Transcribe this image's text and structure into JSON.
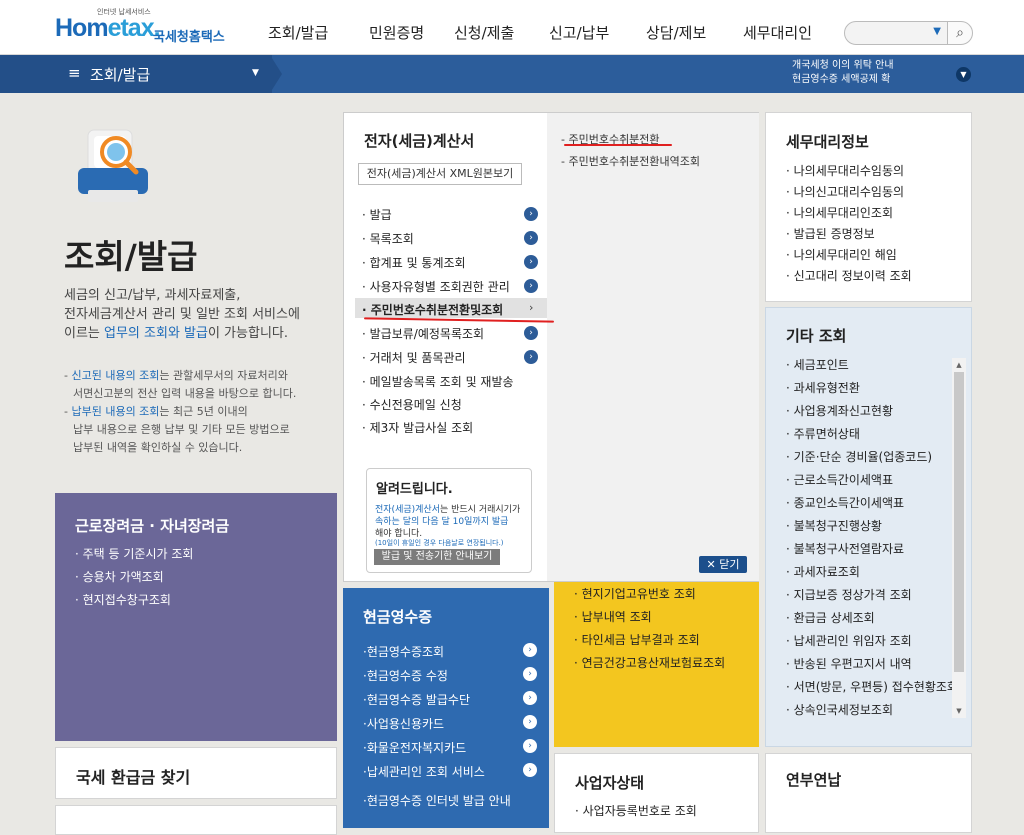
{
  "header": {
    "logo_main": "Hom",
    "logo_accent": "etax.",
    "logo_tagline": "인터넷 납세서비스",
    "logo_subtitle": "국세청홈택스",
    "menu": [
      "조회/발급",
      "민원증명",
      "신청/제출",
      "신고/납부",
      "상담/제보",
      "세무대리인"
    ],
    "search_placeholder": ""
  },
  "subbar": {
    "title": "조회/발급",
    "notices": [
      "개국세청 이의 위탁 안내",
      "현금영수증 세액공제 확"
    ]
  },
  "hero": {
    "title": "조회/발급",
    "desc_line1": "세금의 신고/납부, 과세자료제출,",
    "desc_line2": "전자세금계산서 관리 및 일반 조회 서비스에",
    "desc_line3_pre": "이르는 ",
    "desc_line3_hl": "업무의 조회와 발급",
    "desc_line3_post": "이 가능합니다.",
    "note1_pre": "- ",
    "note1_hl": "신고된 내용의 조회",
    "note1_post": "는 관할세무서의 자료처리와",
    "note1_line2": "서면신고분의 전산 입력 내용을 바탕으로 합니다.",
    "note2_pre": "- ",
    "note2_hl": "납부된 내용의 조회",
    "note2_post": "는 최근 5년 이내의",
    "note2_line2": "납부 내용으로 은행 납부 및 기타 모든 방법으로",
    "note2_line3": "납부된 내역을 확인하실 수 있습니다."
  },
  "purple_card": {
    "title": "근로장려금 · 자녀장려금",
    "items": [
      "· 주택 등 기준시가 조회",
      "· 승용차 가액조회",
      "· 현지접수창구조회"
    ]
  },
  "refund_card": {
    "title": "국세 환급금 찾기"
  },
  "mega_menu": {
    "title": "전자(세금)계산서",
    "xml_button": "전자(세금)계산서 XML원본보기",
    "items": [
      "· 발급",
      "· 목록조회",
      "· 합계표 및 통계조회",
      "· 사용자유형별 조회권한 관리",
      "· 주민번호수취분전환및조회",
      "· 발급보류/예정목록조회",
      "· 거래처 및 품목관리",
      "· 메일발송목록 조회 및 재발송",
      "· 수신전용메일 신청",
      "· 제3자 발급사실 조회"
    ],
    "sub_items": [
      "- 주민번호수취분전환",
      "- 주민번호수취분전환내역조회"
    ],
    "notice": {
      "title": "알려드립니다.",
      "text_hl": "전자(세금)계산서",
      "text_post": "는 반드시 거래시기가",
      "text_line2_hl": "속하는 달의 다음 달 10일까지 발급",
      "text_line3": "해야 합니다.",
      "small": "(10일이 휴일인 경우 다음날로 연장됩니다.)",
      "button": "발급 및 전송기한 안내보기"
    },
    "close_label": "✕ 닫기"
  },
  "yellow_card": {
    "items": [
      "· 현지기업고유번호 조회",
      "· 납부내역 조회",
      "· 타인세금 납부결과 조회",
      "· 연금건강고용산재보험료조회"
    ]
  },
  "cash_card": {
    "title": "현금영수증",
    "items": [
      "·현금영수증조회",
      "·현금영수증 수정",
      "·현금영수증 발급수단",
      "·사업용신용카드",
      "·화물운전자복지카드",
      "·납세관리인 조회 서비스",
      "·현금영수증 인터넷 발급 안내"
    ]
  },
  "biz_card": {
    "title": "사업자상태",
    "items": [
      "· 사업자등록번호로 조회"
    ]
  },
  "agent_card": {
    "title": "세무대리정보",
    "items": [
      "· 나의세무대리수임동의",
      "· 나의신고대리수임동의",
      "· 나의세무대리인조회",
      "· 발급된 증명정보",
      "· 나의세무대리인 해임",
      "· 신고대리 정보이력 조회"
    ]
  },
  "other_card": {
    "title": "기타 조회",
    "items": [
      "· 세금포인트",
      "· 과세유형전환",
      "· 사업용계좌신고현황",
      "· 주류면허상태",
      "· 기준·단순 경비율(업종코드)",
      "· 근로소득간이세액표",
      "· 종교인소득간이세액표",
      "· 불복청구진행상황",
      "· 불복청구사전열람자료",
      "· 과세자료조회",
      "· 지급보증 정상가격 조회",
      "· 환급금 상세조회",
      "· 납세관리인 위임자 조회",
      "· 반송된 우편고지서 내역",
      "· 서면(방문, 우편등) 접수현황조회",
      "· 상속인국세정보조회"
    ]
  },
  "tax_card": {
    "title": "연부연납"
  }
}
